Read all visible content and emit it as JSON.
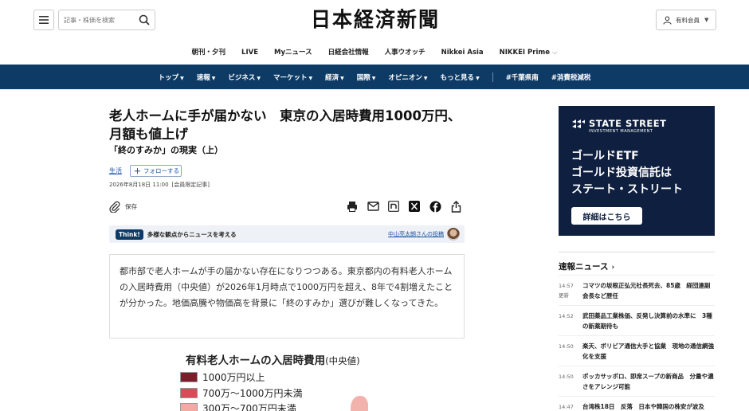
{
  "header": {
    "search_placeholder": "記事・株価を検索",
    "logo_text": "日本経済新聞",
    "member_label": "有料会員"
  },
  "subnav": {
    "items": [
      "朝刊・夕刊",
      "LIVE",
      "Myニュース",
      "日経会社情報",
      "人事ウオッチ",
      "Nikkei Asia",
      "NIKKEI Prime"
    ]
  },
  "mainnav": {
    "items": [
      "トップ",
      "速報",
      "ビジネス",
      "マーケット",
      "経済",
      "国際",
      "オピニオン",
      "もっと見る"
    ],
    "tags": [
      "#千葉県南",
      "#消費税減税"
    ]
  },
  "article": {
    "headline": "老人ホームに手が届かない　東京の入居時費用1000万円、月額も値上げ",
    "subhead": "「終のすみか」の現実（上）",
    "topic": "生活",
    "follow_label": "フォローする",
    "date": "2026年8月18日 11:00",
    "access_tag": "[会員限定記事]",
    "save_label": "保存",
    "think_badge": "Think!",
    "think_text": "多様な観点からニュースを考える",
    "think_author": "中山亮太朗さんの投稿",
    "lead": "都市部で老人ホームが手の届かない存在になりつつある。東京都内の有料老人ホームの入居時費用（中央値）が2026年1月時点で1000万円を超え、8年で4割増えたことが分かった。地価高騰や物価高を背景に「終のすみか」選びが難しくなってきた。"
  },
  "infographic": {
    "title": "有料老人ホームの入居時費用",
    "title_suffix": "(中央値)",
    "legend": [
      {
        "label": "1000万円以上",
        "color": "#7b1e2a"
      },
      {
        "label": "700万～1000万円未満",
        "color": "#d94b57"
      },
      {
        "label": "300万～700万円未満",
        "color": "#f3aaa5"
      }
    ]
  },
  "ad": {
    "brand_name": "STATE STREET",
    "brand_sub": "INVESTMENT MANAGEMENT",
    "line1": "ゴールドETF",
    "line2": "ゴールド投資信託は",
    "line3": "ステート・ストリート",
    "cta": "詳細はこちら"
  },
  "news": {
    "header": "速報ニュース",
    "items": [
      {
        "time": "14:57",
        "time2": "更新",
        "title": "コマツの坂根正弘元社長死去、85歳　経団連副会長など歴任"
      },
      {
        "time": "14:52",
        "time2": "",
        "title": "武田薬品工業株価、反発し決算前の水準に　3種の新薬期待も"
      },
      {
        "time": "14:50",
        "time2": "",
        "title": "楽天、ボリビア通信大手と協業　現地の通信網強化を支援"
      },
      {
        "time": "14:50",
        "time2": "",
        "title": "ポッカサッポロ、即席スープの新商品　分量や濃さをアレンジ可能"
      },
      {
        "time": "14:47",
        "time2": "",
        "title": "台湾株18日　反落　日本や韓国の株安が波及"
      }
    ]
  }
}
